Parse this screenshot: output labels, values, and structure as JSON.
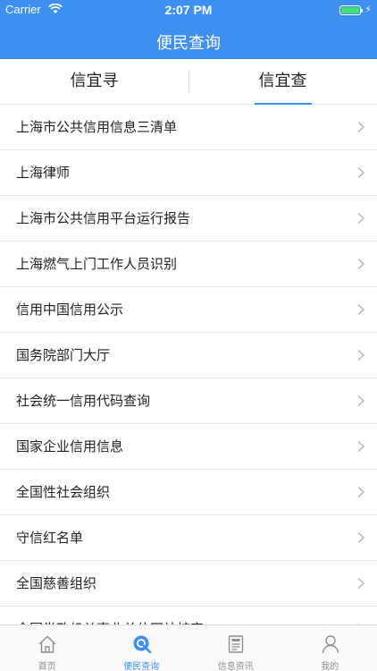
{
  "status_bar": {
    "carrier": "Carrier",
    "time": "2:07 PM"
  },
  "header": {
    "title": "便民查询"
  },
  "tabs": [
    {
      "label": "信宜寻",
      "active": false
    },
    {
      "label": "信宜查",
      "active": true
    }
  ],
  "list": {
    "items": [
      "上海市公共信用信息三清单",
      "上海律师",
      "上海市公共信用平台运行报告",
      "上海燃气上门工作人员识别",
      "信用中国信用公示",
      "国务院部门大厅",
      "社会统一信用代码查询",
      "国家企业信用信息",
      "全国性社会组织",
      "守信红名单",
      "全国慈善组织",
      "全国党政机关事业单位网站核实"
    ]
  },
  "tabbar": {
    "items": [
      {
        "label": "首页",
        "icon": "home-icon",
        "active": false
      },
      {
        "label": "便民查询",
        "icon": "search-icon",
        "active": true
      },
      {
        "label": "信息资讯",
        "icon": "document-icon",
        "active": false
      },
      {
        "label": "我的",
        "icon": "person-icon",
        "active": false
      }
    ]
  },
  "colors": {
    "accent": "#3d8ff0",
    "battery": "#44e06e"
  }
}
